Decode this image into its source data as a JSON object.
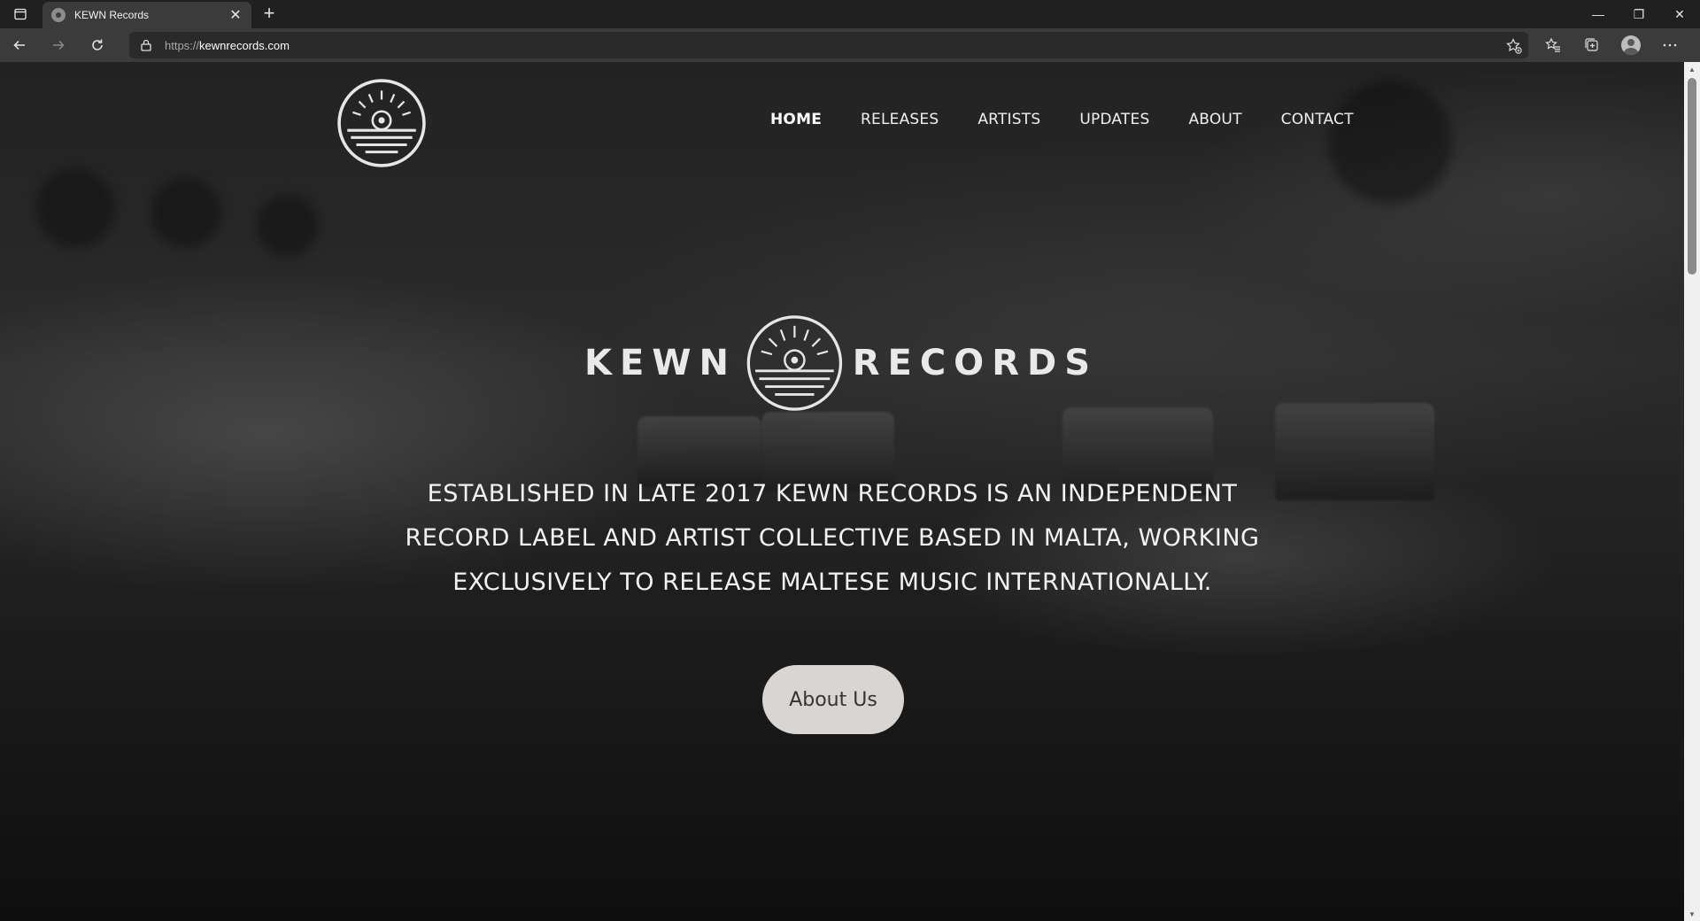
{
  "browser": {
    "tab_title": "KEWN Records",
    "new_tab_symbol": "+",
    "close_symbol": "✕",
    "url_protocol": "https://",
    "url_host": "kewnrecords.com",
    "window_controls": {
      "minimize": "—",
      "restore": "❐",
      "close": "✕"
    }
  },
  "site": {
    "nav": [
      {
        "label": "HOME",
        "active": true
      },
      {
        "label": "RELEASES",
        "active": false
      },
      {
        "label": "ARTISTS",
        "active": false
      },
      {
        "label": "UPDATES",
        "active": false
      },
      {
        "label": "ABOUT",
        "active": false
      },
      {
        "label": "CONTACT",
        "active": false
      }
    ],
    "brand_left": "KEWN",
    "brand_right": "RECORDS",
    "hero_lines": [
      "ESTABLISHED IN LATE 2017 KEWN RECORDS IS AN INDEPENDENT",
      "RECORD LABEL AND ARTIST COLLECTIVE BASED IN MALTA, WORKING",
      "EXCLUSIVELY TO RELEASE MALTESE MUSIC INTERNATIONALLY."
    ],
    "cta_label": "About Us"
  },
  "colors": {
    "chrome_dark": "#202020",
    "chrome_mid": "#3b3b3b",
    "cta_bg": "#d9d5d3",
    "cta_text": "#333333"
  }
}
